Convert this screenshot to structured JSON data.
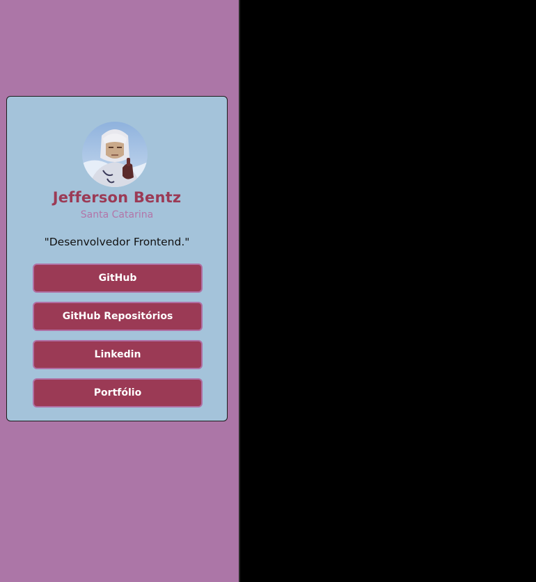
{
  "profile": {
    "name": "Jefferson Bentz",
    "location": "Santa Catarina",
    "bio": "\"Desenvolvedor Frontend.\"",
    "avatar_icon": "profile-avatar-anime-character"
  },
  "links": [
    {
      "label": "GitHub"
    },
    {
      "label": "GitHub Repositórios"
    },
    {
      "label": "Linkedin"
    },
    {
      "label": "Portfólio"
    }
  ],
  "colors": {
    "page_background": "#ac76a7",
    "card_background": "#a4c3da",
    "accent": "#9b3a55",
    "location_text": "#b275a8",
    "button_border": "#b070a4",
    "outside_viewport": "#000000"
  }
}
